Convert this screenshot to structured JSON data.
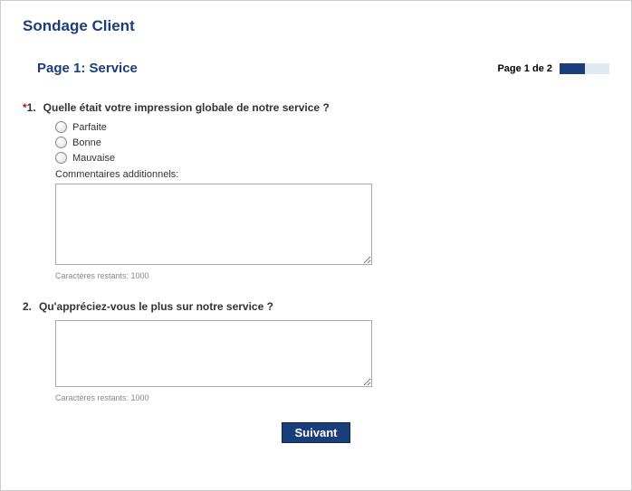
{
  "survey": {
    "title": "Sondage Client"
  },
  "page": {
    "title": "Page 1: Service",
    "indicator": "Page 1 de 2"
  },
  "q1": {
    "required_mark": "*",
    "number": "1.",
    "text": "Quelle était votre impression globale de notre service ?",
    "options": {
      "a": "Parfaite",
      "b": "Bonne",
      "c": "Mauvaise"
    },
    "comment_label": "Commentaires additionnels:",
    "char_count": "Caractères restants: 1000"
  },
  "q2": {
    "number": "2.",
    "text": "Qu'appréciez-vous le plus sur notre service ?",
    "char_count": "Caractères restants: 1000"
  },
  "buttons": {
    "next": "Suivant"
  }
}
